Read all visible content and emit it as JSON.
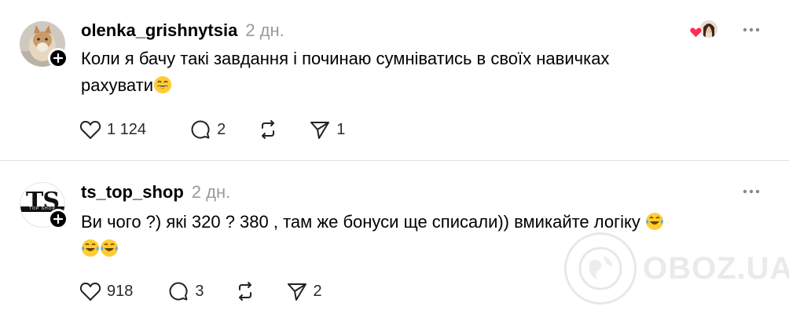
{
  "posts": [
    {
      "username": "olenka_grishnytsia",
      "time": "2 дн.",
      "text_line1": "Коли я бачу такі завдання і починаю сумніватись в своїх навичках",
      "text_line2": "рахувати",
      "likes": "1 124",
      "replies": "2",
      "shares": "1"
    },
    {
      "username": "ts_top_shop",
      "avatar_text": "TS",
      "avatar_small_text": "TOP SHOP",
      "time": "2 дн.",
      "text_line1": "Ви чого ?) які 320 ? 380 , там же бонуси ще списали)) вмикайте логіку",
      "likes": "918",
      "replies": "3",
      "shares": "2"
    }
  ],
  "watermark": {
    "text": "OBOZ.UA"
  },
  "icons": {
    "like": "heart-icon",
    "reply": "speech-bubble-icon",
    "repost": "repost-icon",
    "share": "send-icon",
    "more": "more-dots-icon",
    "follow": "plus-icon"
  }
}
